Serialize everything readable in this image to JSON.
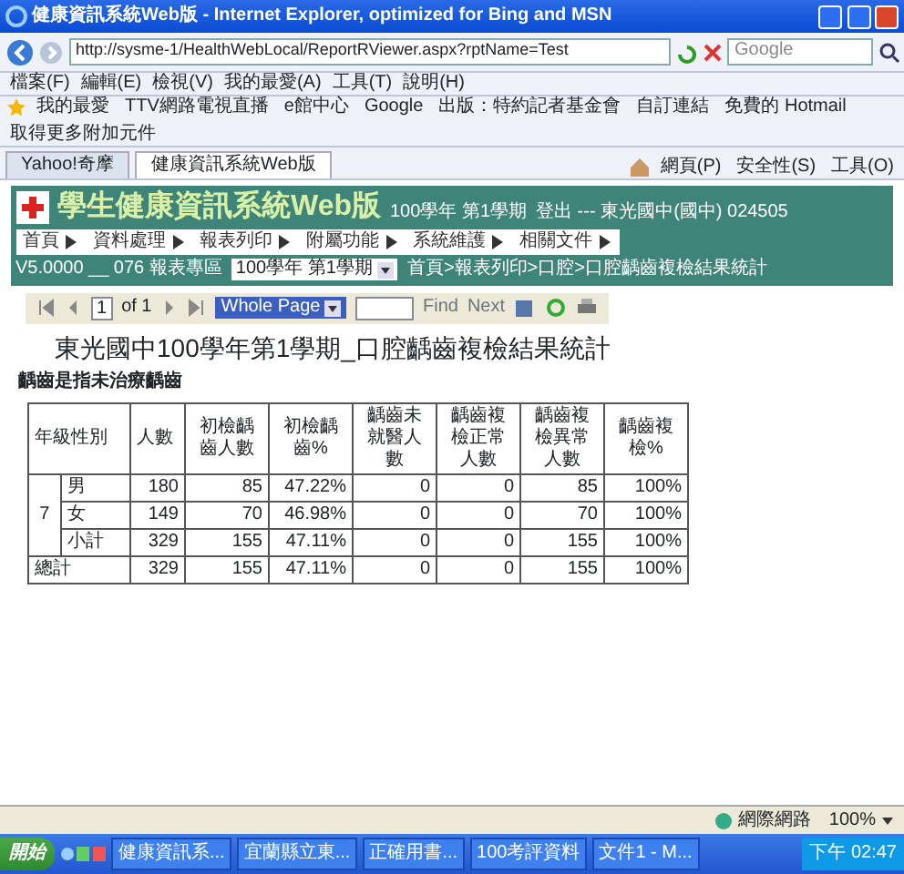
{
  "window": {
    "title": "健康資訊系統Web版 - Internet Explorer, optimized for Bing and MSN"
  },
  "address_bar": {
    "url": "http://sysme-1/HealthWebLocal/ReportRViewer.aspx?rptName=Test",
    "search_placeholder": "Google"
  },
  "menu_bar": [
    "檔案(F)",
    "編輯(E)",
    "檢視(V)",
    "我的最愛(A)",
    "工具(T)",
    "說明(H)"
  ],
  "favorites_bar": [
    "我的最愛",
    "TTV網路電視直播",
    "e館中心",
    "Google",
    "出版：特約記者基金會",
    "自訂連結",
    "免費的 Hotmail",
    "取得更多附加元件"
  ],
  "tabs": [
    {
      "label": "Yahoo!奇摩",
      "selected": false
    },
    {
      "label": "健康資訊系統Web版",
      "selected": true
    }
  ],
  "command_bar": [
    "網頁(P)",
    "安全性(S)",
    "工具(O)"
  ],
  "app_header": {
    "title": "學生健康資訊系統Web版",
    "term": "100學年 第1學期",
    "user": "登出 --- 東光國中(國中) 024505"
  },
  "app_nav": [
    "首頁",
    "資料處理",
    "報表列印",
    "附屬功能",
    "系統維護",
    "相關文件"
  ],
  "info_bar": {
    "version": "V5.0000 __ 076 報表專區",
    "term_select": "100學年 第1學期",
    "breadcrumb": "首頁>報表列印>口腔>口腔齲齒複檢結果統計"
  },
  "report_toolbar": {
    "page": "1",
    "page_count": "of 1",
    "zoom": "Whole Page",
    "find": "Find",
    "next": "Next"
  },
  "report": {
    "title": "東光國中100學年第1學期_口腔齲齒複檢結果統計",
    "subtitle": "齲齒是指未治療齲齒",
    "columns": [
      "年級性別",
      "人數",
      "初檢齲齒人數",
      "初檢齲齒%",
      "齲齒未就醫人數",
      "齲齒複檢正常人數",
      "齲齒複檢異常人數",
      "齲齒複檢%"
    ],
    "groups": [
      {
        "grade": "7",
        "rows": [
          {
            "sex": "男",
            "values": [
              "180",
              "85",
              "47.22%",
              "0",
              "0",
              "85",
              "100%"
            ]
          },
          {
            "sex": "女",
            "values": [
              "149",
              "70",
              "46.98%",
              "0",
              "0",
              "70",
              "100%"
            ]
          },
          {
            "sex": "小計",
            "values": [
              "329",
              "155",
              "47.11%",
              "0",
              "0",
              "155",
              "100%"
            ]
          }
        ]
      }
    ],
    "total": {
      "label": "總計",
      "values": [
        "329",
        "155",
        "47.11%",
        "0",
        "0",
        "155",
        "100%"
      ]
    }
  },
  "status_bar": {
    "zone": "網際網路",
    "zoom": "100%"
  },
  "taskbar": {
    "start": "開始",
    "items": [
      "健康資訊系...",
      "宜蘭縣立東...",
      "正確用書...",
      "100考評資料",
      "文件1 - M..."
    ],
    "clock": "下午 02:47"
  }
}
